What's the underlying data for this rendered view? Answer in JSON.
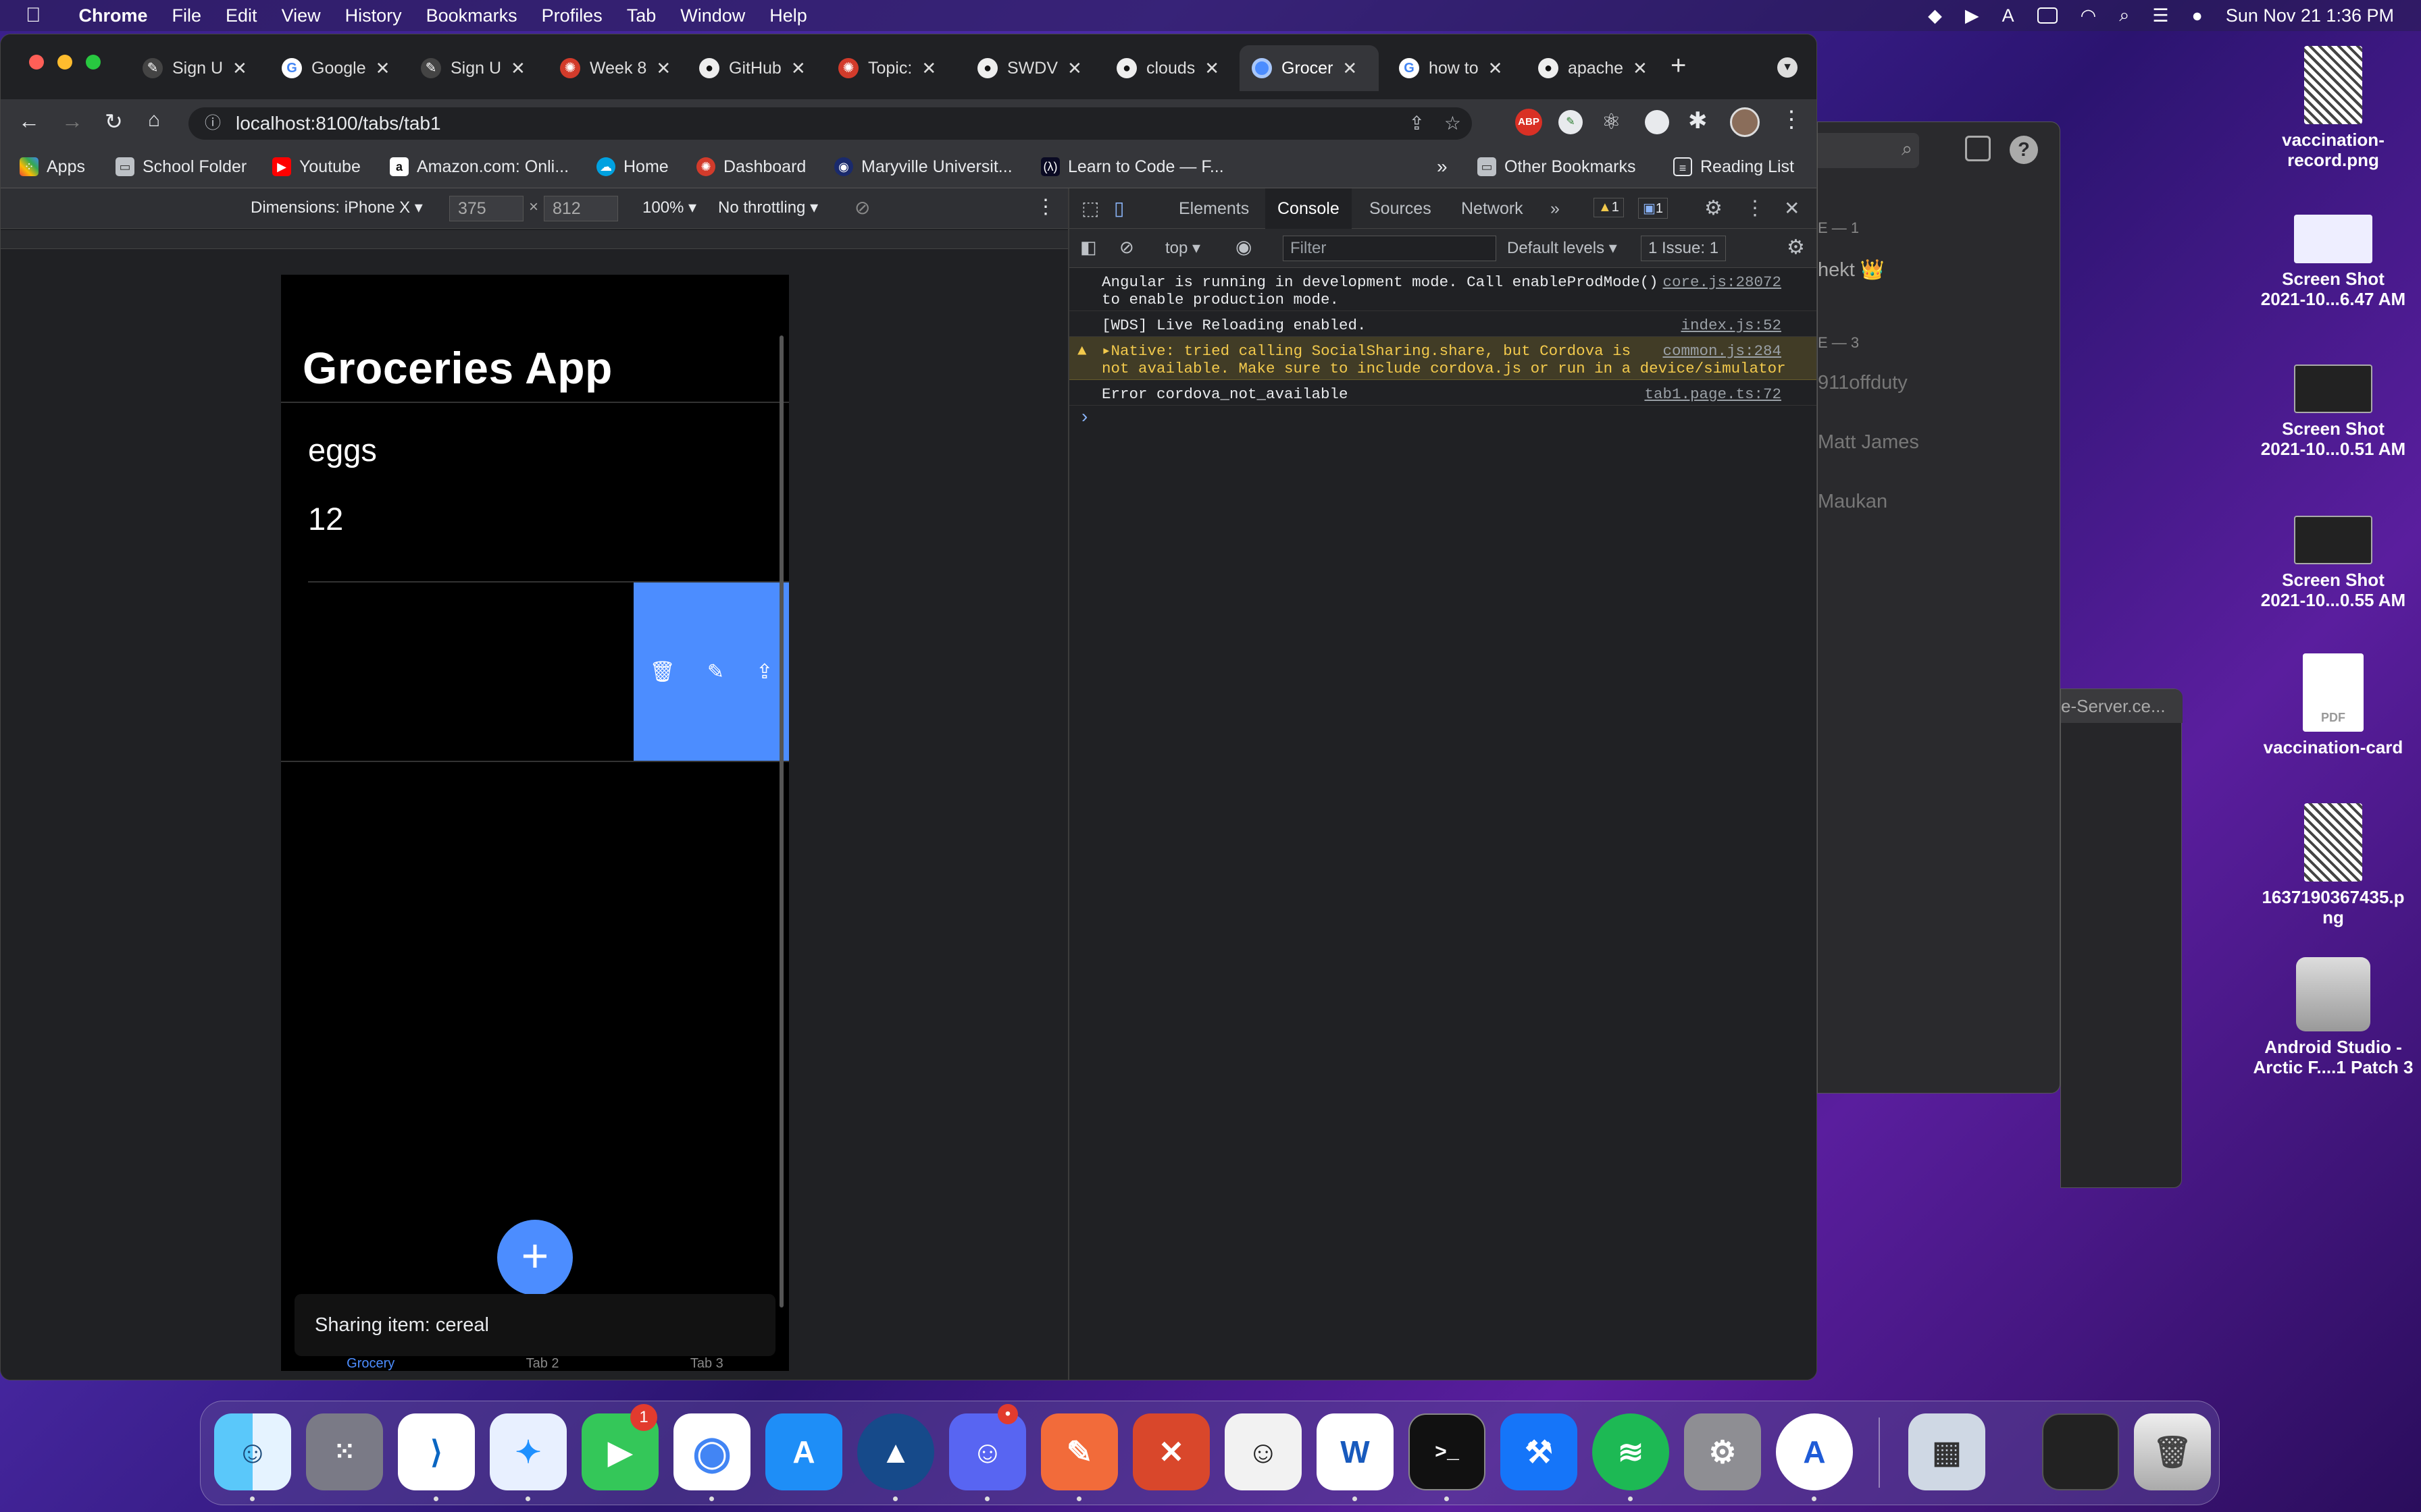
{
  "menubar": {
    "apple": "",
    "app_name": "Chrome",
    "items": [
      "File",
      "Edit",
      "View",
      "History",
      "Bookmarks",
      "Profiles",
      "Tab",
      "Window",
      "Help"
    ],
    "datetime": "Sun Nov 21  1:36 PM"
  },
  "tabs": [
    {
      "label": "Sign U",
      "icon": "sign-icon"
    },
    {
      "label": "Google",
      "icon": "google-icon"
    },
    {
      "label": "Sign U",
      "icon": "sign-icon"
    },
    {
      "label": "Week 8",
      "icon": "canvas-icon"
    },
    {
      "label": "GitHub",
      "icon": "github-icon"
    },
    {
      "label": "Topic:",
      "icon": "canvas-icon"
    },
    {
      "label": "SWDV",
      "icon": "github-icon"
    },
    {
      "label": "clouds",
      "icon": "github-icon"
    },
    {
      "label": "Grocer",
      "icon": "chrome-icon",
      "active": true
    },
    {
      "label": "how to",
      "icon": "google-icon"
    },
    {
      "label": "apache",
      "icon": "github-icon"
    }
  ],
  "address": {
    "url": "localhost:8100/tabs/tab1"
  },
  "bookmarks": [
    {
      "label": "Apps"
    },
    {
      "label": "School Folder"
    },
    {
      "label": "Youtube"
    },
    {
      "label": "Amazon.com: Onli..."
    },
    {
      "label": "Home"
    },
    {
      "label": "Dashboard"
    },
    {
      "label": "Maryville Universit..."
    },
    {
      "label": "Learn to Code — F..."
    }
  ],
  "bookmarks_more": "»",
  "other_bookmarks": "Other Bookmarks",
  "reading_list": "Reading List",
  "device": {
    "dimensions": "Dimensions: iPhone X ▾",
    "width": "375",
    "x": "×",
    "height": "812",
    "zoom": "100% ▾",
    "throttle": "No throttling ▾"
  },
  "app": {
    "title": "Groceries App",
    "item_name": "eggs",
    "item_qty": "12",
    "fab": "+",
    "toast": "Sharing item: cereal",
    "tabs": [
      "Grocery",
      "Tab 2",
      "Tab 3"
    ]
  },
  "devtools": {
    "tabs": [
      "Elements",
      "Console",
      "Sources",
      "Network"
    ],
    "more": "»",
    "warn_count": "1",
    "msg_count": "1",
    "context": "top ▾",
    "filter_placeholder": "Filter",
    "levels": "Default levels ▾",
    "issues": "1 Issue:  1",
    "lines": [
      {
        "text": "Angular is running in development mode. Call enableProdMode()\nto enable production mode.",
        "src": "core.js:28072",
        "type": "log"
      },
      {
        "text": "[WDS] Live Reloading enabled.",
        "src": "index.js:52",
        "type": "log"
      },
      {
        "text": "▸Native: tried calling SocialSharing.share, but Cordova is\nnot available. Make sure to include cordova.js or run in a device/simulator",
        "src": "common.js:284",
        "type": "warn"
      },
      {
        "text": "Error cordova_not_available",
        "src": "tab1.page.ts:72",
        "type": "log"
      }
    ],
    "prompt": "›"
  },
  "behind": {
    "lines": [
      "E — 1",
      "hekt 👑",
      "E — 3",
      "911offduty",
      "Matt James",
      "Maukan"
    ],
    "server": "e-Server.ce..."
  },
  "desktop": [
    {
      "label": "vaccination-\nrecord.png"
    },
    {
      "label": "Screen Shot\n2021-10...6.47 AM"
    },
    {
      "label": "Screen Shot\n2021-10...0.51 AM"
    },
    {
      "label": "Screen Shot\n2021-10...0.55 AM"
    },
    {
      "label": "vaccination-card"
    },
    {
      "label": "1637190367435.p\nng"
    },
    {
      "label": "Android Studio -\nArctic F....1 Patch 3"
    }
  ],
  "dock": {
    "facetime_badge": "1",
    "discord_badge": "•",
    "apps": [
      "finder-icon",
      "launchpad-icon",
      "vscode-icon",
      "safari-icon",
      "facetime-icon",
      "chrome-icon",
      "appstore-icon",
      "ike-icon",
      "discord-icon",
      "paw-icon",
      "remote-desktop-icon",
      "memoji-icon",
      "word-icon",
      "terminal-icon",
      "xcode-icon",
      "spotify-icon",
      "system-prefs-icon",
      "instruments-icon",
      "preview-icon",
      "screenshot-icon",
      "trash-icon"
    ]
  },
  "colors": {
    "accent": "#4c8dff",
    "warning_bg": "#413c26",
    "warning_text": "#f2c94c"
  }
}
